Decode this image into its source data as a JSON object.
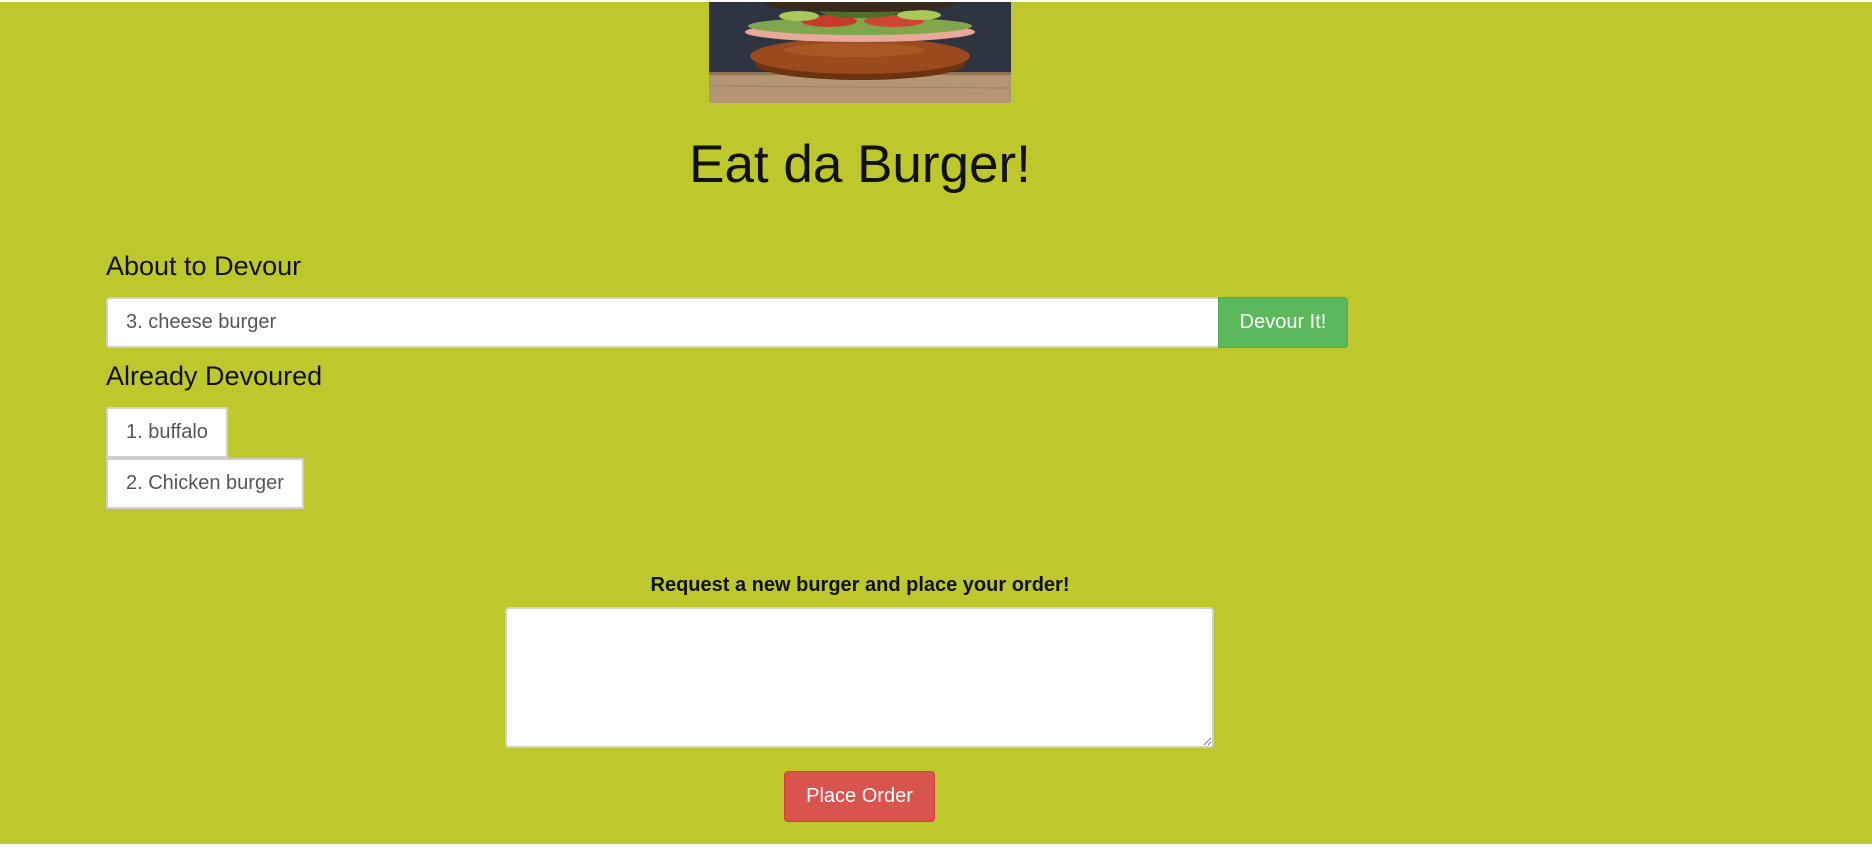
{
  "app": {
    "title": "Eat da Burger!",
    "background_color": "#bec72c",
    "hero_image": "burger-photo"
  },
  "devour_section": {
    "heading": "About to Devour",
    "items": [
      {
        "label": "3. cheese burger",
        "button_label": "Devour It!"
      }
    ]
  },
  "devoured_section": {
    "heading": "Already Devoured",
    "items": [
      {
        "label": "1. buffalo"
      },
      {
        "label": "2. Chicken burger"
      }
    ]
  },
  "order_form": {
    "label": "Request a new burger and place your order!",
    "textarea_value": "",
    "submit_label": "Place Order"
  },
  "colors": {
    "devour_button": "#5cb85c",
    "place_order_button": "#d9534f"
  }
}
